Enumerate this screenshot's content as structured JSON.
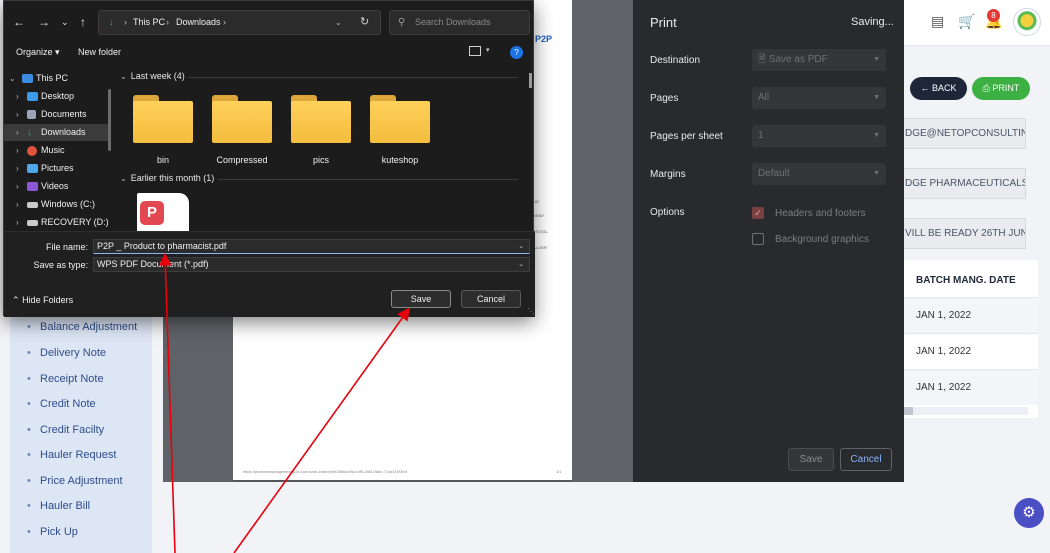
{
  "app": {
    "sidebar_menu": [
      "Balance Adjustment",
      "Delivery Note",
      "Receipt Note",
      "Credit Note",
      "Credit Facilty",
      "Hauler Request",
      "Price Adjustment",
      "Hauler Bill",
      "Pick Up"
    ],
    "header": {
      "notification_count": "8",
      "menu_icon": "list-icon",
      "cart_icon": "cart-icon",
      "bell_icon": "bell-icon"
    },
    "logo_text": "P2P",
    "back_label": "BACK",
    "print_label": "PRINT",
    "info_fields": [
      "DGE@NETOPCONSULTIN",
      "DGE PHARMACEUTICALS",
      "VILL BE READY 26TH JUN"
    ],
    "table": {
      "header": "BATCH MANG. DATE",
      "rows": [
        "JAN 1, 2022",
        "JAN 1, 2022",
        "JAN 1, 2022"
      ]
    },
    "settings_icon": "gear-icon"
  },
  "preview": {
    "footer_url": "https://pharmamanagement.p2p.com/sale-order/print/36bdc5fa-e4f5-4fd3-9a6e-71de1f1f0b4f",
    "page_num": "1/1",
    "snippets": [
      "LW",
      "54987",
      "4TOTAL",
      "ALLIER"
    ]
  },
  "print_panel": {
    "title": "Print",
    "status": "Saving...",
    "destination_label": "Destination",
    "destination_value": "Save as PDF",
    "pages_label": "Pages",
    "pages_value": "All",
    "pps_label": "Pages per sheet",
    "pps_value": "1",
    "margins_label": "Margins",
    "margins_value": "Default",
    "options_label": "Options",
    "opt_headers": "Headers and footers",
    "opt_background": "Background graphics",
    "save_label": "Save",
    "cancel_label": "Cancel"
  },
  "dialog": {
    "breadcrumb": [
      "This PC",
      "Downloads"
    ],
    "search_placeholder": "Search Downloads",
    "organize_label": "Organize",
    "new_folder_label": "New folder",
    "nav": [
      "This PC",
      "Desktop",
      "Documents",
      "Downloads",
      "Music",
      "Pictures",
      "Videos",
      "Windows (C:)",
      "RECOVERY (D:)"
    ],
    "group_last_week": "Last week (4)",
    "group_earlier": "Earlier this month (1)",
    "folders": [
      "bin",
      "Compressed",
      "pics",
      "kuteshop"
    ],
    "file_name_label": "File name:",
    "file_name_value": "P2P _ Product to pharmacist.pdf",
    "save_type_label": "Save as type:",
    "save_type_value": "WPS PDF Document (*.pdf)",
    "hide_folders_label": "Hide Folders",
    "save_label": "Save",
    "cancel_label": "Cancel"
  },
  "colors": {
    "accent_blue": "#1a73e8",
    "print_green": "#3cb043",
    "annotation_red": "#e8000b",
    "pdf_red": "#e34850"
  }
}
